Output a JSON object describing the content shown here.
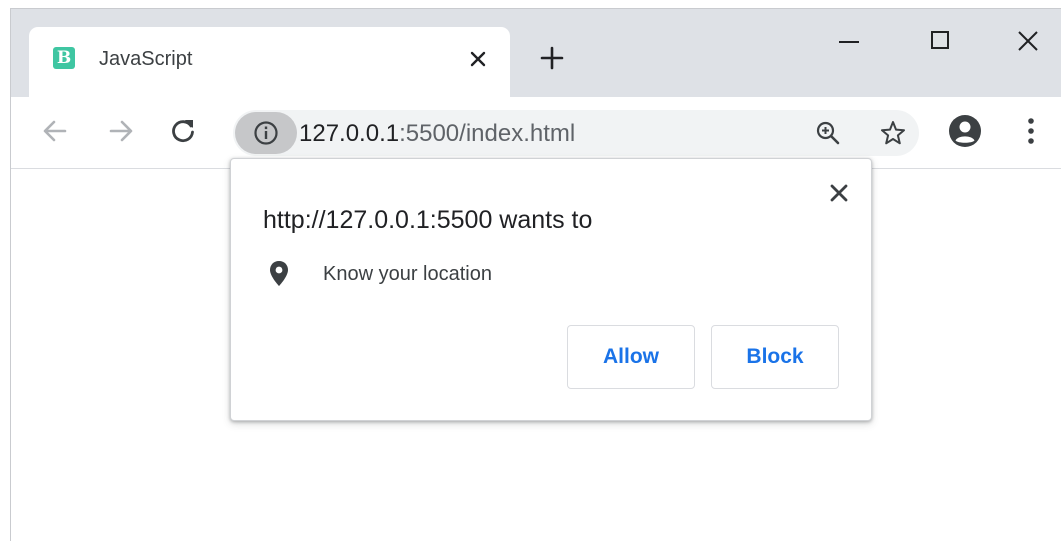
{
  "tab": {
    "favicon_letter": "B",
    "title": "JavaScript",
    "close_label": "×"
  },
  "new_tab_label": "+",
  "window_controls": {
    "close_label": "✕"
  },
  "toolbar": {
    "url_host": "127.0.0.1",
    "url_path": ":5500/index.html"
  },
  "permission_popup": {
    "title": "http://127.0.0.1:5500 wants to",
    "permission": "Know your location",
    "allow_label": "Allow",
    "block_label": "Block"
  },
  "colors": {
    "accent": "#1a73e8",
    "favicon": "#3fc6a2",
    "tabstrip": "#dee1e6",
    "omnibox": "#f1f3f4"
  },
  "icons": [
    "back-arrow-icon",
    "forward-arrow-icon",
    "reload-icon",
    "info-icon",
    "zoom-icon",
    "star-icon",
    "profile-icon",
    "menu-icon",
    "close-icon",
    "location-pin-icon"
  ]
}
